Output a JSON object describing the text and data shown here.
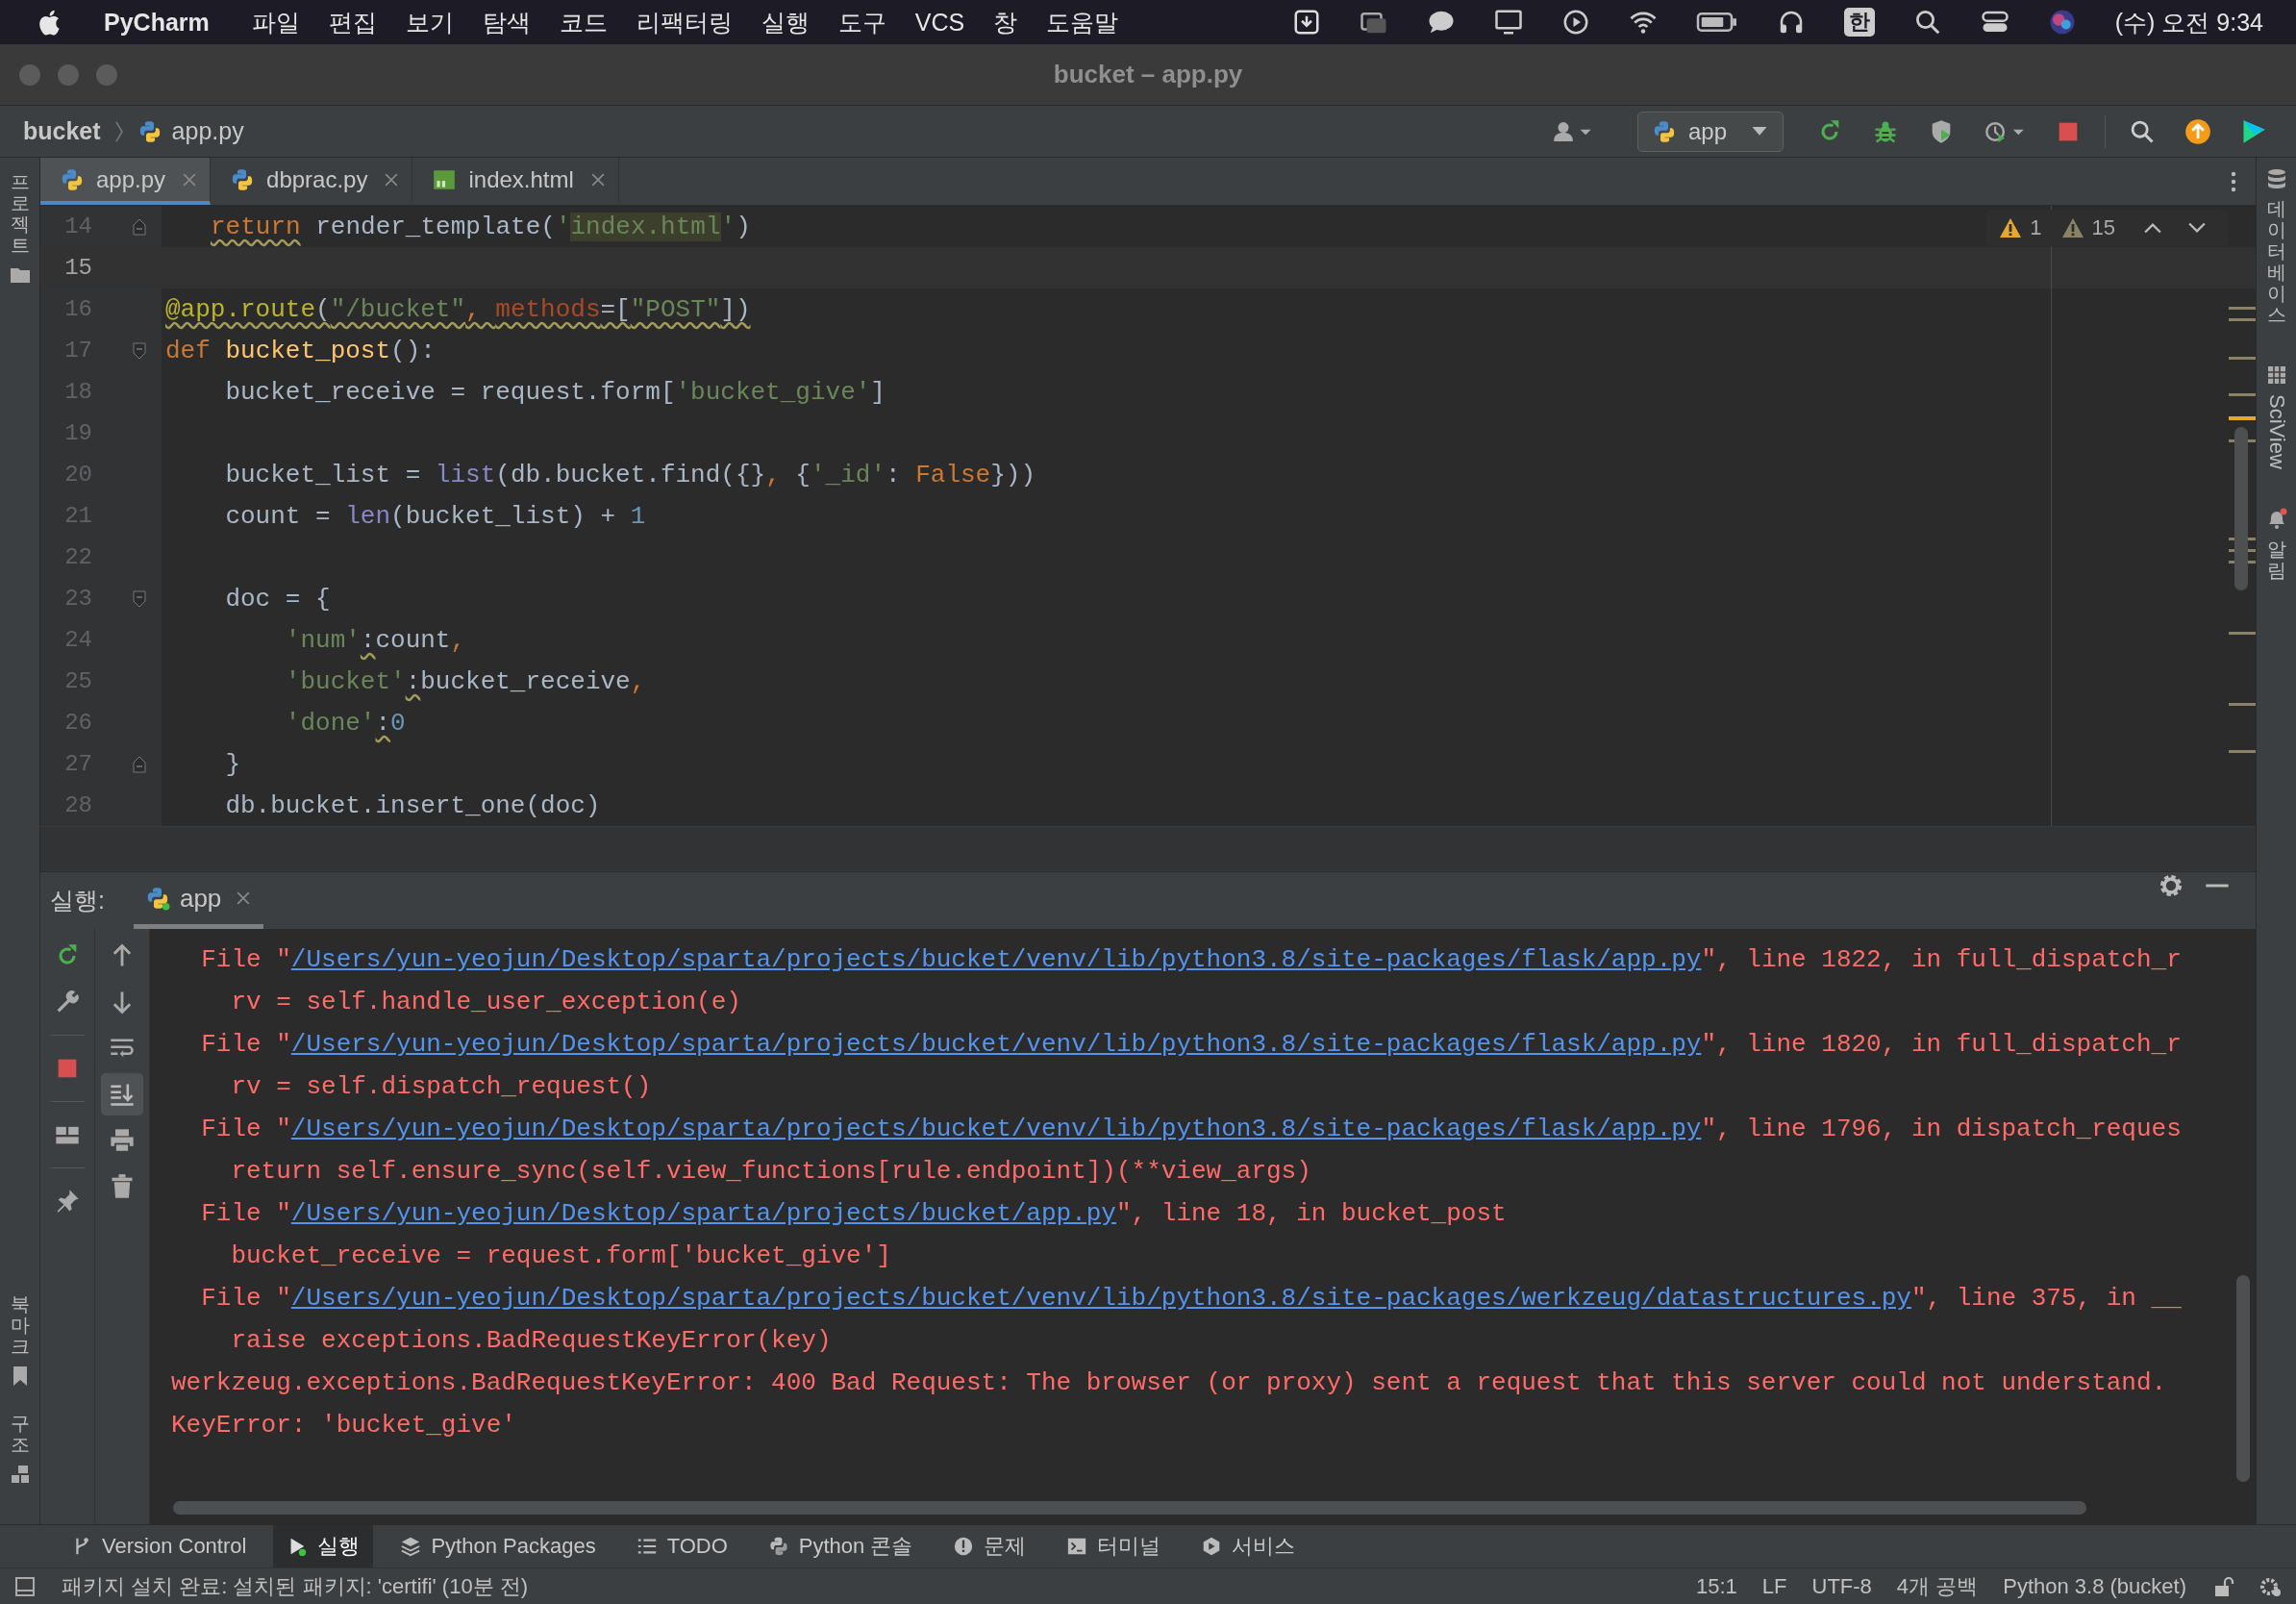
{
  "menubar": {
    "app": "PyCharm",
    "menus": [
      "파일",
      "편집",
      "보기",
      "탐색",
      "코드",
      "리팩터링",
      "실행",
      "도구",
      "VCS",
      "창",
      "도움말"
    ],
    "input_source": "한",
    "clock": "(수) 오전 9:34"
  },
  "window": {
    "title": "bucket – app.py"
  },
  "navbar": {
    "breadcrumbs": [
      "bucket",
      "app.py"
    ],
    "run_config": "app"
  },
  "tabs": [
    {
      "label": "app.py",
      "kind": "python",
      "selected": true
    },
    {
      "label": "dbprac.py",
      "kind": "python",
      "selected": false
    },
    {
      "label": "index.html",
      "kind": "html",
      "selected": false
    }
  ],
  "left_strip": [
    {
      "label": "프로젝트",
      "kind": "folder"
    },
    {
      "label": "북마크",
      "kind": "bookmark"
    },
    {
      "label": "구조",
      "kind": "structure"
    }
  ],
  "right_strip": [
    {
      "label": "데이터베이스",
      "kind": "database"
    },
    {
      "label": "SciView",
      "kind": "grid"
    },
    {
      "label": "알림",
      "kind": "bell"
    }
  ],
  "editor": {
    "inspections": [
      {
        "kind": "warning",
        "count": "1"
      },
      {
        "kind": "weak_warning",
        "count": "15"
      }
    ],
    "lines": [
      {
        "number": "14",
        "current": false,
        "kind": "fold_end",
        "tokens": [
          {
            "kind": "keyword_warn_indent",
            "text": "return"
          },
          {
            "kind": "plain",
            "text": " render_template("
          },
          {
            "kind": "string",
            "text": "'"
          },
          {
            "kind": "string_match",
            "text": "index.html"
          },
          {
            "kind": "string",
            "text": "'"
          },
          {
            "kind": "plain",
            "text": ")"
          }
        ]
      },
      {
        "number": "15",
        "current": true,
        "kind": "code"
      },
      {
        "number": "16",
        "current": false,
        "kind": "code",
        "tokens": [
          {
            "kind": "decorator_warn",
            "text": "@app.route"
          },
          {
            "kind": "plain_warn",
            "text": "("
          },
          {
            "kind": "string_warn",
            "text": "\"/bucket\""
          },
          {
            "kind": "keyword_warn",
            "text": ", "
          },
          {
            "kind": "param_warn",
            "text": "methods"
          },
          {
            "kind": "plain_warn",
            "text": "=["
          },
          {
            "kind": "string_warn",
            "text": "\"POST\""
          },
          {
            "kind": "plain_warn",
            "text": "])"
          }
        ]
      },
      {
        "number": "17",
        "current": false,
        "kind": "fold_start",
        "tokens": [
          {
            "kind": "keyword",
            "text": "def "
          },
          {
            "kind": "function",
            "text": "bucket_post"
          },
          {
            "kind": "plain",
            "text": "():"
          }
        ]
      },
      {
        "number": "18",
        "current": false,
        "kind": "code",
        "tokens": [
          {
            "kind": "plain",
            "text": "    bucket_receive = request.form["
          },
          {
            "kind": "string",
            "text": "'bucket_give'"
          },
          {
            "kind": "plain",
            "text": "]"
          }
        ]
      },
      {
        "number": "19",
        "current": false,
        "kind": "code"
      },
      {
        "number": "20",
        "current": false,
        "kind": "code",
        "tokens": [
          {
            "kind": "plain",
            "text": "    bucket_list = "
          },
          {
            "kind": "builtin",
            "text": "list"
          },
          {
            "kind": "plain",
            "text": "(db.bucket.find({}"
          },
          {
            "kind": "keyword",
            "text": ", "
          },
          {
            "kind": "plain",
            "text": "{"
          },
          {
            "kind": "string",
            "text": "'_id'"
          },
          {
            "kind": "plain",
            "text": ": "
          },
          {
            "kind": "keyword",
            "text": "False"
          },
          {
            "kind": "plain",
            "text": "}))"
          }
        ]
      },
      {
        "number": "21",
        "current": false,
        "kind": "code",
        "tokens": [
          {
            "kind": "plain",
            "text": "    count = "
          },
          {
            "kind": "builtin",
            "text": "len"
          },
          {
            "kind": "plain",
            "text": "(bucket_list) + "
          },
          {
            "kind": "number",
            "text": "1"
          }
        ]
      },
      {
        "number": "22",
        "current": false,
        "kind": "code"
      },
      {
        "number": "23",
        "current": false,
        "kind": "fold_start",
        "tokens": [
          {
            "kind": "plain",
            "text": "    doc = {"
          }
        ]
      },
      {
        "number": "24",
        "current": false,
        "kind": "code",
        "tokens": [
          {
            "kind": "string",
            "text": "        'num'"
          },
          {
            "kind": "plain_warn",
            "text": ":"
          },
          {
            "kind": "plain",
            "text": "count"
          },
          {
            "kind": "keyword",
            "text": ","
          }
        ]
      },
      {
        "number": "25",
        "current": false,
        "kind": "code",
        "tokens": [
          {
            "kind": "string",
            "text": "        'bucket'"
          },
          {
            "kind": "plain_warn",
            "text": ":"
          },
          {
            "kind": "plain",
            "text": "bucket_receive"
          },
          {
            "kind": "keyword",
            "text": ","
          }
        ]
      },
      {
        "number": "26",
        "current": false,
        "kind": "code",
        "tokens": [
          {
            "kind": "string",
            "text": "        'done'"
          },
          {
            "kind": "plain_warn",
            "text": ":"
          },
          {
            "kind": "number",
            "text": "0"
          }
        ]
      },
      {
        "number": "27",
        "current": false,
        "kind": "fold_end",
        "tokens": [
          {
            "kind": "plain",
            "text": "    }"
          }
        ]
      },
      {
        "number": "28",
        "current": false,
        "kind": "code",
        "tokens": [
          {
            "kind": "plain",
            "text": "    db.bucket.insert_one(doc)"
          }
        ]
      }
    ]
  },
  "run_panel": {
    "label": "실행:",
    "tabs": [
      {
        "label": "app",
        "selected": true
      }
    ],
    "console": [
      {
        "kind": "file",
        "before": "  File \"",
        "path": "/Users/yun-yeojun/Desktop/sparta/projects/bucket/venv/lib/python3.8/site-packages/flask/app.py",
        "after": "\", line 1822, in full_dispatch_r"
      },
      {
        "kind": "code",
        "text": "    rv = self.handle_user_exception(e)"
      },
      {
        "kind": "file",
        "before": "  File \"",
        "path": "/Users/yun-yeojun/Desktop/sparta/projects/bucket/venv/lib/python3.8/site-packages/flask/app.py",
        "after": "\", line 1820, in full_dispatch_r"
      },
      {
        "kind": "code",
        "text": "    rv = self.dispatch_request()"
      },
      {
        "kind": "file",
        "before": "  File \"",
        "path": "/Users/yun-yeojun/Desktop/sparta/projects/bucket/venv/lib/python3.8/site-packages/flask/app.py",
        "after": "\", line 1796, in dispatch_reques"
      },
      {
        "kind": "code",
        "text": "    return self.ensure_sync(self.view_functions[rule.endpoint])(**view_args)"
      },
      {
        "kind": "file",
        "before": "  File \"",
        "path": "/Users/yun-yeojun/Desktop/sparta/projects/bucket/app.py",
        "after": "\", line 18, in bucket_post"
      },
      {
        "kind": "code",
        "text": "    bucket_receive = request.form['bucket_give']"
      },
      {
        "kind": "file",
        "before": "  File \"",
        "path": "/Users/yun-yeojun/Desktop/sparta/projects/bucket/venv/lib/python3.8/site-packages/werkzeug/datastructures.py",
        "after": "\", line 375, in __"
      },
      {
        "kind": "code",
        "text": "    raise exceptions.BadRequestKeyError(key)"
      },
      {
        "kind": "error",
        "text": "werkzeug.exceptions.BadRequestKeyError: 400 Bad Request: The browser (or proxy) sent a request that this server could not understand."
      },
      {
        "kind": "error",
        "text": "KeyError: 'bucket_give'"
      }
    ]
  },
  "tool_windows": [
    {
      "label": "Version Control",
      "kind": "vcs",
      "selected": false
    },
    {
      "label": "실행",
      "kind": "run",
      "selected": true
    },
    {
      "label": "Python Packages",
      "kind": "packages",
      "selected": false
    },
    {
      "label": "TODO",
      "kind": "todo",
      "selected": false
    },
    {
      "label": "Python 콘솔",
      "kind": "console",
      "selected": false
    },
    {
      "label": "문제",
      "kind": "problems",
      "selected": false
    },
    {
      "label": "터미널",
      "kind": "terminal",
      "selected": false
    },
    {
      "label": "서비스",
      "kind": "services",
      "selected": false
    }
  ],
  "status_bar": {
    "message": "패키지 설치 완료: 설치된 패키지: 'certifi' (10분 전)",
    "items": [
      "15:1",
      "LF",
      "UTF-8",
      "4개 공백",
      "Python 3.8 (bucket)"
    ]
  }
}
